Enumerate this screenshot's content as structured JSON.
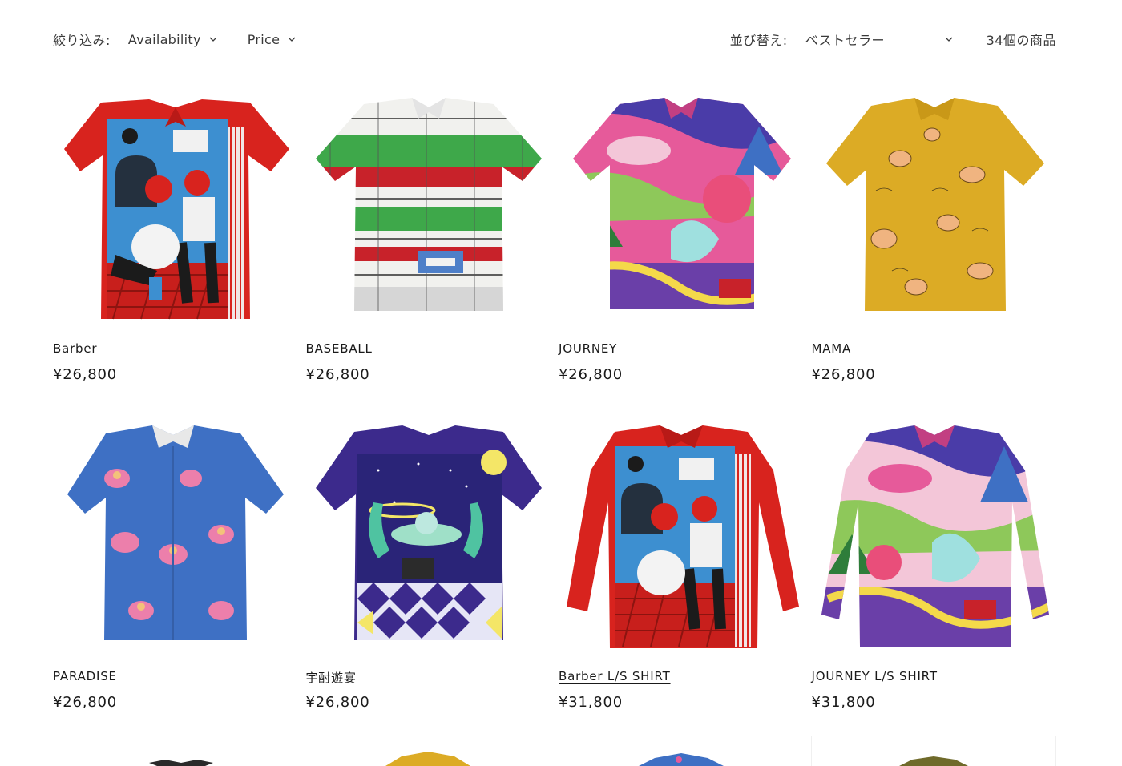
{
  "filter_bar": {
    "filter_label": "絞り込み:",
    "availability_label": "Availability",
    "price_label": "Price",
    "sort_label": "並び替え:",
    "sort_value": "ベストセラー",
    "product_count": "34個の商品"
  },
  "products": [
    {
      "name": "Barber",
      "price": "¥26,800",
      "icon": "short-sleeve-shirt-red-barber-print"
    },
    {
      "name": "BASEBALL",
      "price": "¥26,800",
      "icon": "short-sleeve-shirt-baseball-print"
    },
    {
      "name": "JOURNEY",
      "price": "¥26,800",
      "icon": "short-sleeve-shirt-journey-print"
    },
    {
      "name": "MAMA",
      "price": "¥26,800",
      "icon": "short-sleeve-shirt-yellow-mama-print"
    },
    {
      "name": "PARADISE",
      "price": "¥26,800",
      "icon": "short-sleeve-shirt-blue-paradise-print"
    },
    {
      "name": "宇酎遊宴",
      "price": "¥26,800",
      "icon": "short-sleeve-shirt-purple-space-print"
    },
    {
      "name": "Barber L/S SHIRT",
      "price": "¥31,800",
      "icon": "long-sleeve-shirt-red-barber-print"
    },
    {
      "name": "JOURNEY L/S SHIRT",
      "price": "¥31,800",
      "icon": "long-sleeve-shirt-journey-print"
    }
  ],
  "colors": {
    "red": "#d8231e",
    "blue": "#3e70c4",
    "green": "#3ea84a",
    "yellow": "#dcab25",
    "purple": "#3c2a8c",
    "pink": "#e65a9a",
    "text": "#121212"
  }
}
